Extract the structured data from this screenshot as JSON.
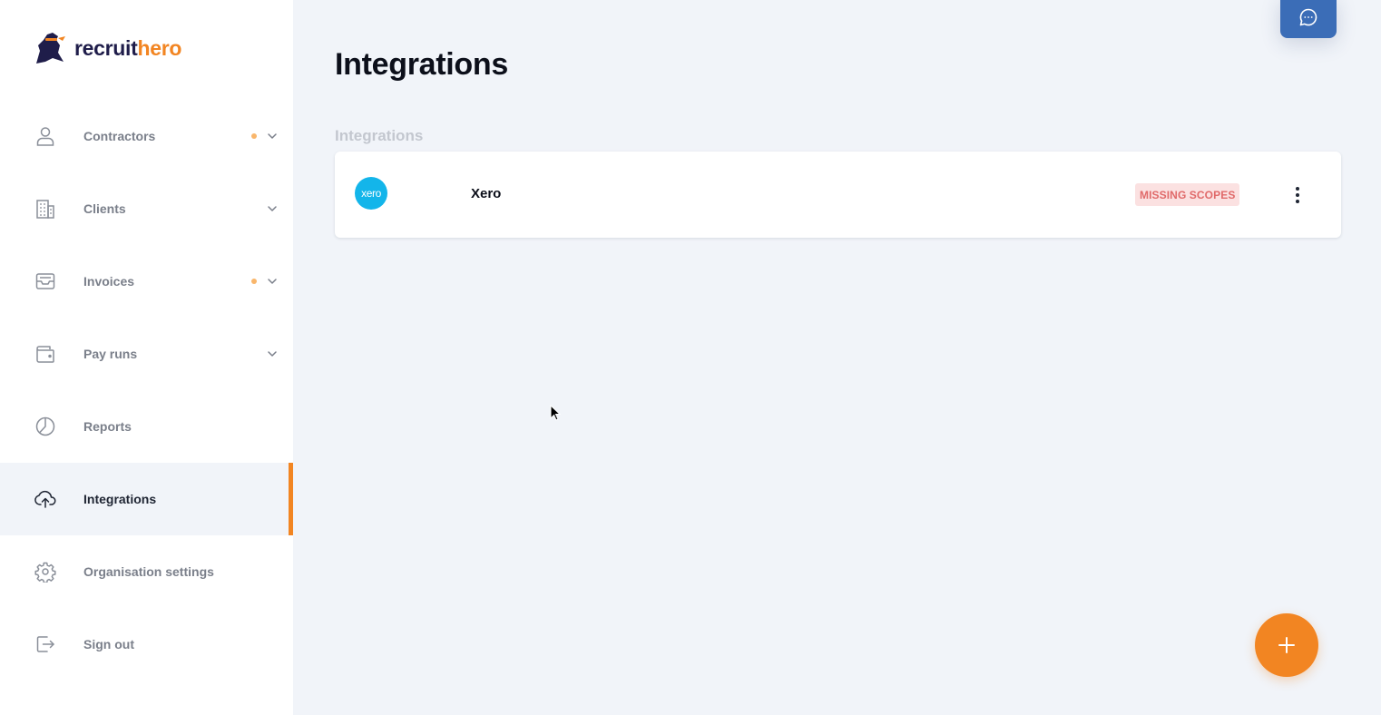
{
  "brand": {
    "name_part1": "recruit",
    "name_part2": "hero",
    "color_dark": "#1f1d4a",
    "color_accent": "#f28522"
  },
  "sidebar": {
    "items": [
      {
        "label": "Contractors",
        "icon": "user-icon",
        "has_dot": true,
        "has_chevron": true,
        "active": false
      },
      {
        "label": "Clients",
        "icon": "building-icon",
        "has_dot": false,
        "has_chevron": true,
        "active": false
      },
      {
        "label": "Invoices",
        "icon": "inbox-icon",
        "has_dot": true,
        "has_chevron": true,
        "active": false
      },
      {
        "label": "Pay runs",
        "icon": "wallet-icon",
        "has_dot": false,
        "has_chevron": true,
        "active": false
      },
      {
        "label": "Reports",
        "icon": "pie-chart-icon",
        "has_dot": false,
        "has_chevron": false,
        "active": false
      },
      {
        "label": "Integrations",
        "icon": "cloud-upload-icon",
        "has_dot": false,
        "has_chevron": false,
        "active": true
      },
      {
        "label": "Organisation settings",
        "icon": "gear-icon",
        "has_dot": false,
        "has_chevron": false,
        "active": false
      },
      {
        "label": "Sign out",
        "icon": "sign-out-icon",
        "has_dot": false,
        "has_chevron": false,
        "active": false
      }
    ],
    "dot_color": "#f9b66b",
    "active_accent": "#f28522"
  },
  "main": {
    "page_title": "Integrations",
    "section_label": "Integrations",
    "integrations": [
      {
        "name": "Xero",
        "logo_text": "xero",
        "logo_color": "#13b5ea",
        "status": "MISSING SCOPES",
        "status_color": "#e06a6a"
      }
    ]
  },
  "actions": {
    "chat_icon": "chat-bubble-icon",
    "chat_color": "#3b6db7",
    "add_icon": "plus-icon",
    "add_color": "#f28522"
  }
}
